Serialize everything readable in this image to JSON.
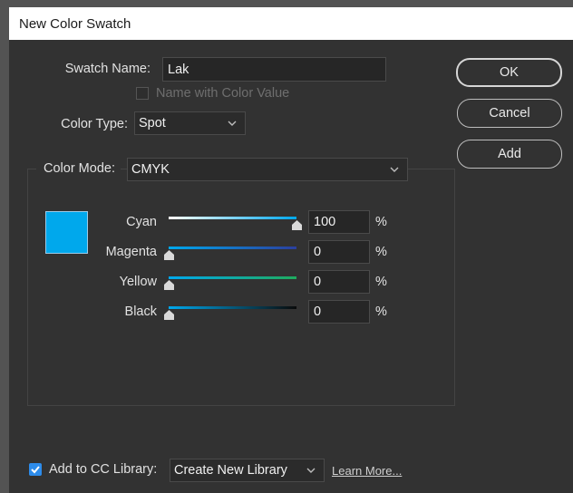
{
  "dialog": {
    "title": "New Color Swatch"
  },
  "swatch_name": {
    "label": "Swatch Name:",
    "value": "Lak"
  },
  "name_with_color_value": {
    "label": "Name with Color Value",
    "checked": false,
    "disabled": true
  },
  "color_type": {
    "label": "Color Type:",
    "value": "Spot"
  },
  "color_mode": {
    "label": "Color Mode:",
    "value": "CMYK"
  },
  "buttons": {
    "ok": "OK",
    "cancel": "Cancel",
    "add": "Add"
  },
  "swatch_color": "#00a8ec",
  "channels": [
    {
      "name": "Cyan",
      "value": "100",
      "unit": "%",
      "level": 1.0,
      "gradient": [
        "#ffffff",
        "#00a8ec"
      ]
    },
    {
      "name": "Magenta",
      "value": "0",
      "unit": "%",
      "level": 0.0,
      "gradient": [
        "#00a8ec",
        "#2b3f9e"
      ]
    },
    {
      "name": "Yellow",
      "value": "0",
      "unit": "%",
      "level": 0.0,
      "gradient": [
        "#00a8ec",
        "#1fab5e"
      ]
    },
    {
      "name": "Black",
      "value": "0",
      "unit": "%",
      "level": 0.0,
      "gradient": [
        "#00a8ec",
        "#0a0a0a"
      ]
    }
  ],
  "cc_library": {
    "checkbox_label": "Add to CC Library:",
    "checked": true,
    "library_value": "Create New Library",
    "learn_more": "Learn More..."
  },
  "colors": {
    "checkbox_accent": "#2d8ceb",
    "dialog_bg": "#323232"
  }
}
